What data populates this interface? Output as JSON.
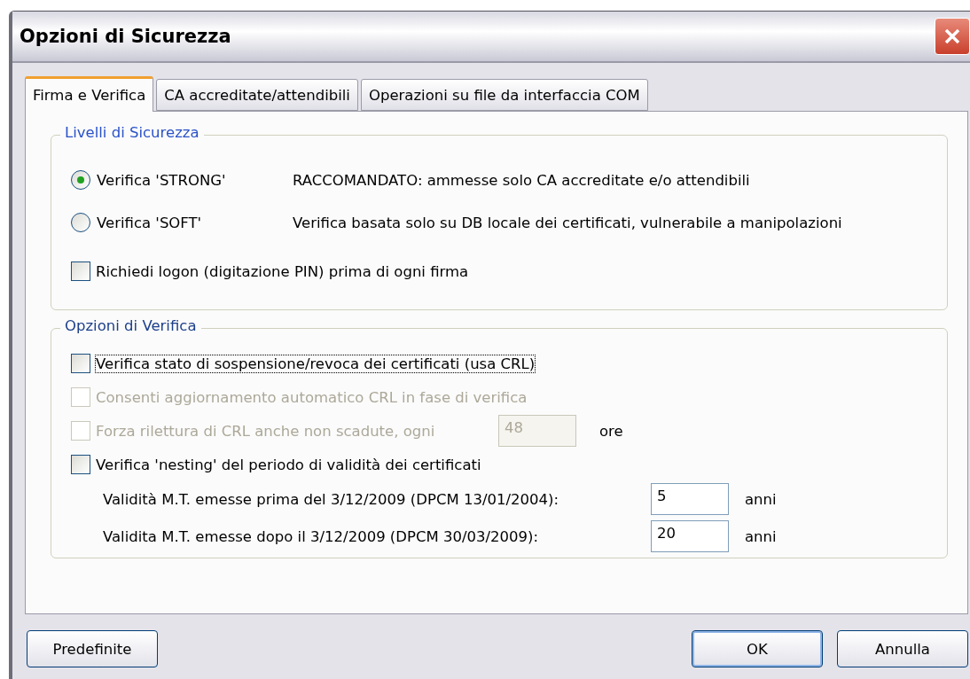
{
  "window": {
    "title": "Opzioni di Sicurezza"
  },
  "tabs": [
    {
      "label": "Firma e Verifica",
      "selected": true
    },
    {
      "label": "CA accreditate/attendibili",
      "selected": false
    },
    {
      "label": "Operazioni su file da interfaccia COM",
      "selected": false
    }
  ],
  "security_levels": {
    "title": "Livelli di Sicurezza",
    "radios": [
      {
        "label": "Verifica 'STRONG'",
        "description": "RACCOMANDATO: ammesse solo CA accreditate e/o attendibili",
        "selected": true
      },
      {
        "label": "Verifica 'SOFT'",
        "description": "Verifica basata solo su DB locale dei certificati, vulnerabile a manipolazioni",
        "selected": false
      }
    ],
    "logon": {
      "label": "Richiedi logon (digitazione PIN) prima di ogni firma",
      "checked": false
    }
  },
  "verification_options": {
    "title": "Opzioni di Verifica",
    "items": [
      {
        "kind": "checkbox",
        "label": "Verifica stato di sospensione/revoca dei certificati (usa CRL)",
        "checked": false,
        "disabled": false,
        "focused": true
      },
      {
        "kind": "checkbox",
        "label": "Consenti aggiornamento automatico CRL in fase di verifica",
        "checked": false,
        "disabled": true,
        "focused": false
      },
      {
        "kind": "checkbox_field",
        "label": "Forza rilettura di CRL anche non scadute, ogni",
        "checked": false,
        "disabled": true,
        "focused": false,
        "value": "48",
        "unit": "ore"
      },
      {
        "kind": "checkbox",
        "label": "Verifica 'nesting' del periodo di validità dei certificati",
        "checked": false,
        "disabled": false,
        "focused": false
      },
      {
        "kind": "field",
        "label": "Validità M.T. emesse prima del 3/12/2009 (DPCM 13/01/2004):",
        "value": "5",
        "unit": "anni"
      },
      {
        "kind": "field",
        "label": "Validita M.T. emesse dopo il 3/12/2009 (DPCM 30/03/2009):",
        "value": "20",
        "unit": "anni"
      }
    ]
  },
  "buttons_left": [
    {
      "label": "Predefinite",
      "default": false
    }
  ],
  "buttons_right": [
    {
      "label": "OK",
      "default": true
    },
    {
      "label": "Annulla",
      "default": false
    }
  ]
}
